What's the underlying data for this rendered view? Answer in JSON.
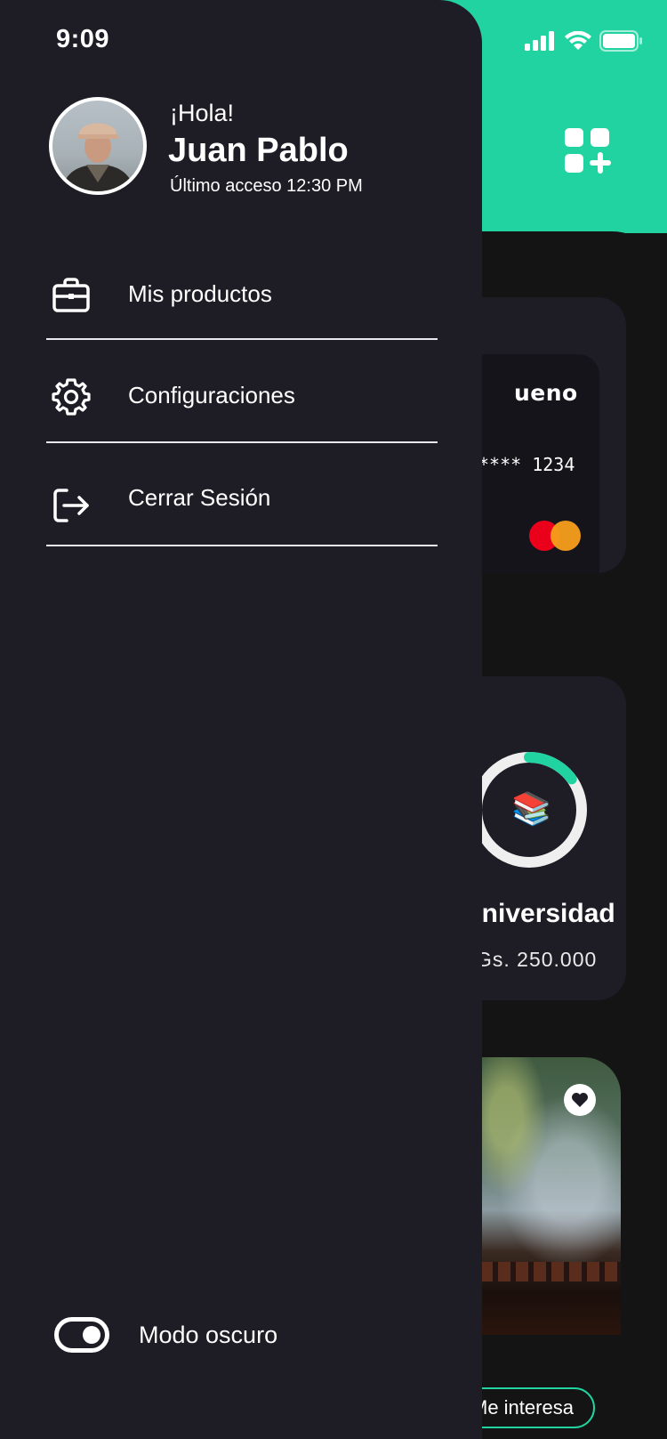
{
  "status_bar": {
    "time": "9:09"
  },
  "drawer": {
    "greeting": "¡Hola!",
    "user_name": "Juan Pablo",
    "last_access": "Último acceso 12:30 PM",
    "menu": [
      {
        "label": "Mis productos",
        "icon": "briefcase-icon"
      },
      {
        "label": "Configuraciones",
        "icon": "gear-icon"
      },
      {
        "label": "Cerrar Sesión",
        "icon": "logout-icon"
      }
    ],
    "dark_mode": {
      "label": "Modo oscuro",
      "enabled": true
    }
  },
  "background": {
    "card": {
      "brand": "ueno",
      "number": "**** 1234",
      "network_icon": "mastercard-logo"
    },
    "goal": {
      "emoji": "📚",
      "name": "Universidad",
      "amount": "Gs. 250.000",
      "progress": 0.15
    },
    "promo": {
      "cta": "Me interesa",
      "favorite_icon": "heart-icon"
    },
    "header_icon": "add-widget-icon"
  },
  "colors": {
    "accent": "#22D3A2",
    "drawer_bg": "#1e1c25",
    "app_bg": "#141414"
  }
}
